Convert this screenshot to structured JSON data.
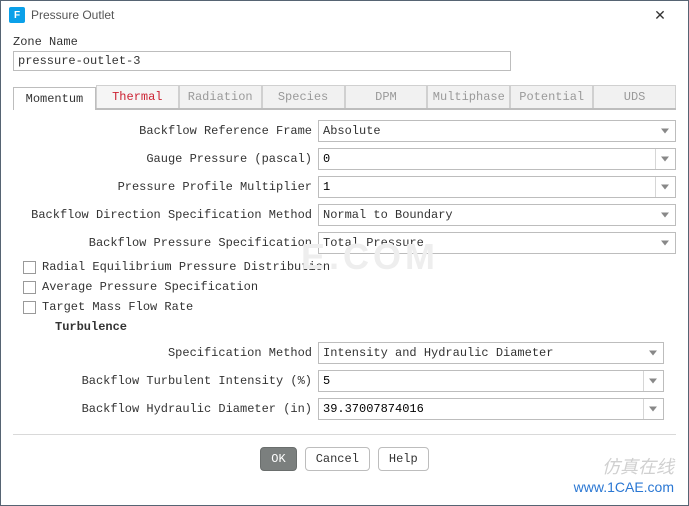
{
  "window": {
    "title": "Pressure Outlet",
    "icon_letter": "F",
    "close_glyph": "✕"
  },
  "zone": {
    "label": "Zone Name",
    "value": "pressure-outlet-3"
  },
  "tabs": [
    "Momentum",
    "Thermal",
    "Radiation",
    "Species",
    "DPM",
    "Multiphase",
    "Potential",
    "UDS"
  ],
  "active_tab": 0,
  "fields": {
    "ref_frame": {
      "label": "Backflow Reference Frame",
      "value": "Absolute"
    },
    "gauge": {
      "label": "Gauge Pressure (pascal)",
      "value": "0"
    },
    "multiplier": {
      "label": "Pressure Profile Multiplier",
      "value": "1"
    },
    "dir_method": {
      "label": "Backflow Direction Specification Method",
      "value": "Normal to Boundary"
    },
    "press_spec": {
      "label": "Backflow Pressure Specification",
      "value": "Total Pressure"
    }
  },
  "checks": {
    "radial": "Radial Equilibrium Pressure Distribution",
    "avg": "Average Pressure Specification",
    "target": "Target Mass Flow Rate"
  },
  "turbulence": {
    "title": "Turbulence",
    "spec": {
      "label": "Specification Method",
      "value": "Intensity and Hydraulic Diameter"
    },
    "intensity": {
      "label": "Backflow Turbulent Intensity (%)",
      "value": "5"
    },
    "diameter": {
      "label": "Backflow Hydraulic Diameter (in)",
      "value": "39.37007874016"
    }
  },
  "buttons": {
    "ok": "OK",
    "cancel": "Cancel",
    "help": "Help"
  },
  "watermark": {
    "line1": "仿真在线",
    "line2": "www.1CAE.com",
    "center": "E.COM"
  }
}
